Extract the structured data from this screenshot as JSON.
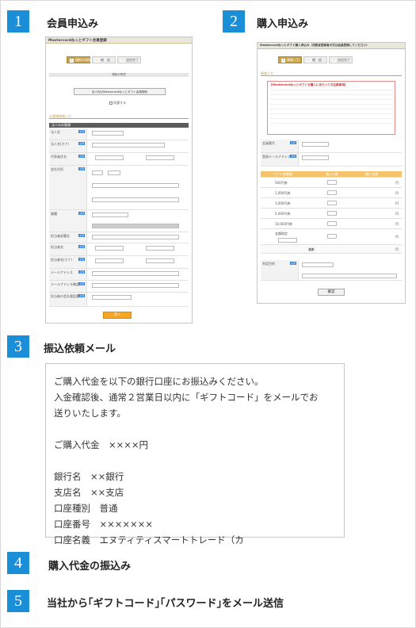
{
  "steps": [
    {
      "num": "1",
      "title": "会員申込み"
    },
    {
      "num": "2",
      "title": "購入申込み"
    },
    {
      "num": "3",
      "title": "振込依頼メール"
    },
    {
      "num": "4",
      "title": "購入代金の振込み"
    },
    {
      "num": "5",
      "title": "当社から｢ギフトコード｣｢パスワード｣をメール送信"
    }
  ],
  "shot1": {
    "header": "Mastercardねっとギフト会員登録",
    "progress": [
      "規約の同意",
      "確　認",
      "送信完了"
    ],
    "agree_title": "規約の同意",
    "agree_button": "法人向けMastercardねっとギフト会員規約",
    "agree_check": "同意する",
    "section_label": "お客様情報入力",
    "sub_section": "法人のお客様",
    "fields": [
      "法人名",
      "法人名(カナ)",
      "代表者氏名",
      "会社住所",
      "業種",
      "担当者部署名",
      "担当者名",
      "担当者名(カナ)",
      "メールアドレス",
      "メールアドレス確認",
      "担当者の会社電話番号"
    ],
    "tags": {
      "required": "必須"
    },
    "submit": "次へ"
  },
  "shot2": {
    "header": "Mastercardねっとギフト購入申込み（法務省登録者の方は会員登録してください）",
    "progress": [
      "情報入力",
      "確　認",
      "送信完了"
    ],
    "section_label": "情報入力",
    "notice_title": "【Mastercardねっとギフトを購入にあたっての注意事項】",
    "fields": [
      "会員番号",
      "登録メールアドレス",
      "利用目的"
    ],
    "table_headers": [
      "ギフト券種類",
      "購入口数",
      "購入金額"
    ],
    "amounts": [
      "500円券",
      "1,000円券",
      "3,000円券",
      "5,000円券",
      "10,000円券",
      "金額指定"
    ],
    "yen": "円",
    "total_label": "合計",
    "confirm_button": "確認"
  },
  "mail": {
    "lines": [
      "ご購入代金を以下の銀行口座にお振込みください。",
      "入金確認後、通常２営業日以内に「ギフトコード」をメールでお",
      "送りいたします。",
      "",
      "ご購入代金　××××円",
      "",
      "銀行名　××銀行",
      "支店名　××支店",
      "口座種別　普通",
      "口座番号　×××××××",
      "口座名義　エヌティティスマートトレード（カ"
    ]
  },
  "colors": {
    "badge": "#1a8fd8",
    "accent": "#c8a24a",
    "button": "#f6a623"
  }
}
